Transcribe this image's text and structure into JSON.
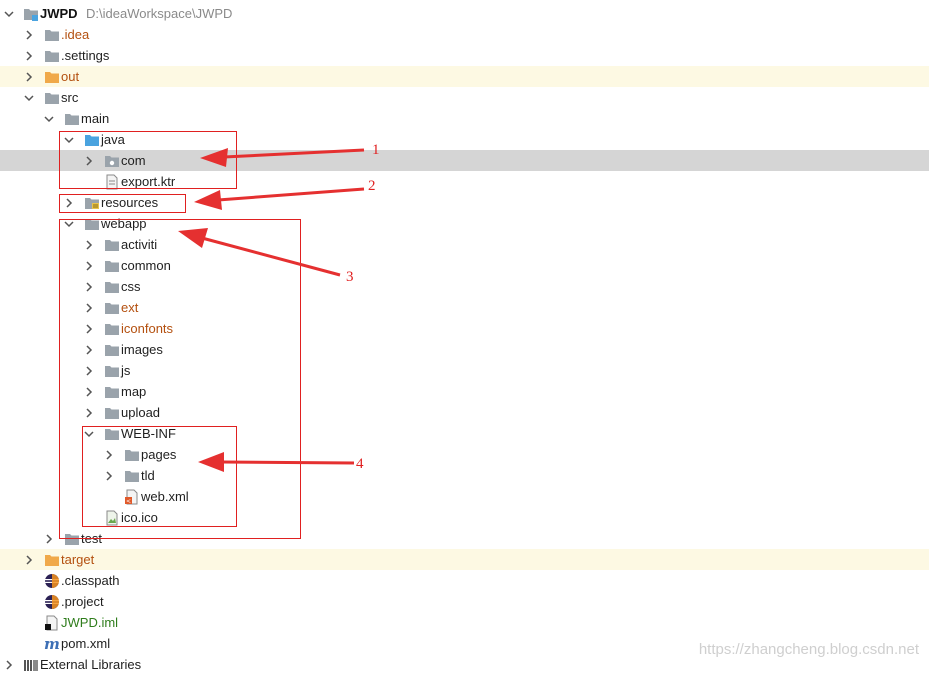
{
  "root": {
    "name": "JWPD",
    "path": "D:\\ideaWorkspace\\JWPD"
  },
  "tree": [
    {
      "label": "JWPD",
      "depth": 0,
      "chevron": "down",
      "icon": "module-folder-icon",
      "bold": true
    },
    {
      "label": ".idea",
      "depth": 1,
      "chevron": "right",
      "icon": "folder-icon",
      "orange": true
    },
    {
      "label": ".settings",
      "depth": 1,
      "chevron": "right",
      "icon": "folder-icon"
    },
    {
      "label": "out",
      "depth": 1,
      "chevron": "right",
      "icon": "excluded-folder-icon",
      "orange": true,
      "excluded": true
    },
    {
      "label": "src",
      "depth": 1,
      "chevron": "down",
      "icon": "folder-icon"
    },
    {
      "label": "main",
      "depth": 2,
      "chevron": "down",
      "icon": "folder-icon"
    },
    {
      "label": "java",
      "depth": 3,
      "chevron": "down",
      "icon": "source-folder-icon"
    },
    {
      "label": "com",
      "depth": 4,
      "chevron": "right",
      "icon": "package-icon",
      "selected": true
    },
    {
      "label": "export.ktr",
      "depth": 4,
      "chevron": "none",
      "icon": "file-icon"
    },
    {
      "label": "resources",
      "depth": 3,
      "chevron": "right",
      "icon": "resources-folder-icon"
    },
    {
      "label": "webapp",
      "depth": 3,
      "chevron": "down",
      "icon": "folder-icon"
    },
    {
      "label": "activiti",
      "depth": 4,
      "chevron": "right",
      "icon": "folder-icon"
    },
    {
      "label": "common",
      "depth": 4,
      "chevron": "right",
      "icon": "folder-icon"
    },
    {
      "label": "css",
      "depth": 4,
      "chevron": "right",
      "icon": "folder-icon"
    },
    {
      "label": "ext",
      "depth": 4,
      "chevron": "right",
      "icon": "folder-icon",
      "orange": true
    },
    {
      "label": "iconfonts",
      "depth": 4,
      "chevron": "right",
      "icon": "folder-icon",
      "orange": true
    },
    {
      "label": "images",
      "depth": 4,
      "chevron": "right",
      "icon": "folder-icon"
    },
    {
      "label": "js",
      "depth": 4,
      "chevron": "right",
      "icon": "folder-icon"
    },
    {
      "label": "map",
      "depth": 4,
      "chevron": "right",
      "icon": "folder-icon"
    },
    {
      "label": "upload",
      "depth": 4,
      "chevron": "right",
      "icon": "folder-icon"
    },
    {
      "label": "WEB-INF",
      "depth": 4,
      "chevron": "down",
      "icon": "folder-icon"
    },
    {
      "label": "pages",
      "depth": 5,
      "chevron": "right",
      "icon": "folder-icon"
    },
    {
      "label": "tld",
      "depth": 5,
      "chevron": "right",
      "icon": "folder-icon"
    },
    {
      "label": "web.xml",
      "depth": 5,
      "chevron": "none",
      "icon": "xml-file-icon"
    },
    {
      "label": "ico.ico",
      "depth": 4,
      "chevron": "none",
      "icon": "image-file-icon"
    },
    {
      "label": "test",
      "depth": 2,
      "chevron": "right",
      "icon": "folder-icon"
    },
    {
      "label": "target",
      "depth": 1,
      "chevron": "right",
      "icon": "excluded-folder-icon",
      "orange": true,
      "excluded": true
    },
    {
      "label": ".classpath",
      "depth": 1,
      "chevron": "none",
      "icon": "eclipse-file-icon"
    },
    {
      "label": ".project",
      "depth": 1,
      "chevron": "none",
      "icon": "eclipse-file-icon"
    },
    {
      "label": "JWPD.iml",
      "depth": 1,
      "chevron": "none",
      "icon": "iml-file-icon",
      "green": true
    },
    {
      "label": "pom.xml",
      "depth": 1,
      "chevron": "none",
      "icon": "maven-icon"
    },
    {
      "label": "External Libraries",
      "depth": 0,
      "chevron": "right",
      "icon": "libraries-icon"
    }
  ],
  "annotations": [
    "1",
    "2",
    "3",
    "4"
  ],
  "watermark": "https://zhangcheng.blog.csdn.net",
  "colors": {
    "folder": "#9aa3ab",
    "excluded_folder": "#f0a94a",
    "source_folder": "#4aa3df",
    "orange_text": "#b4500f",
    "green_text": "#2f7d1c",
    "annotation": "#e02020",
    "selection": "#d5d5d5",
    "excluded_row": "#fdf9e3"
  }
}
